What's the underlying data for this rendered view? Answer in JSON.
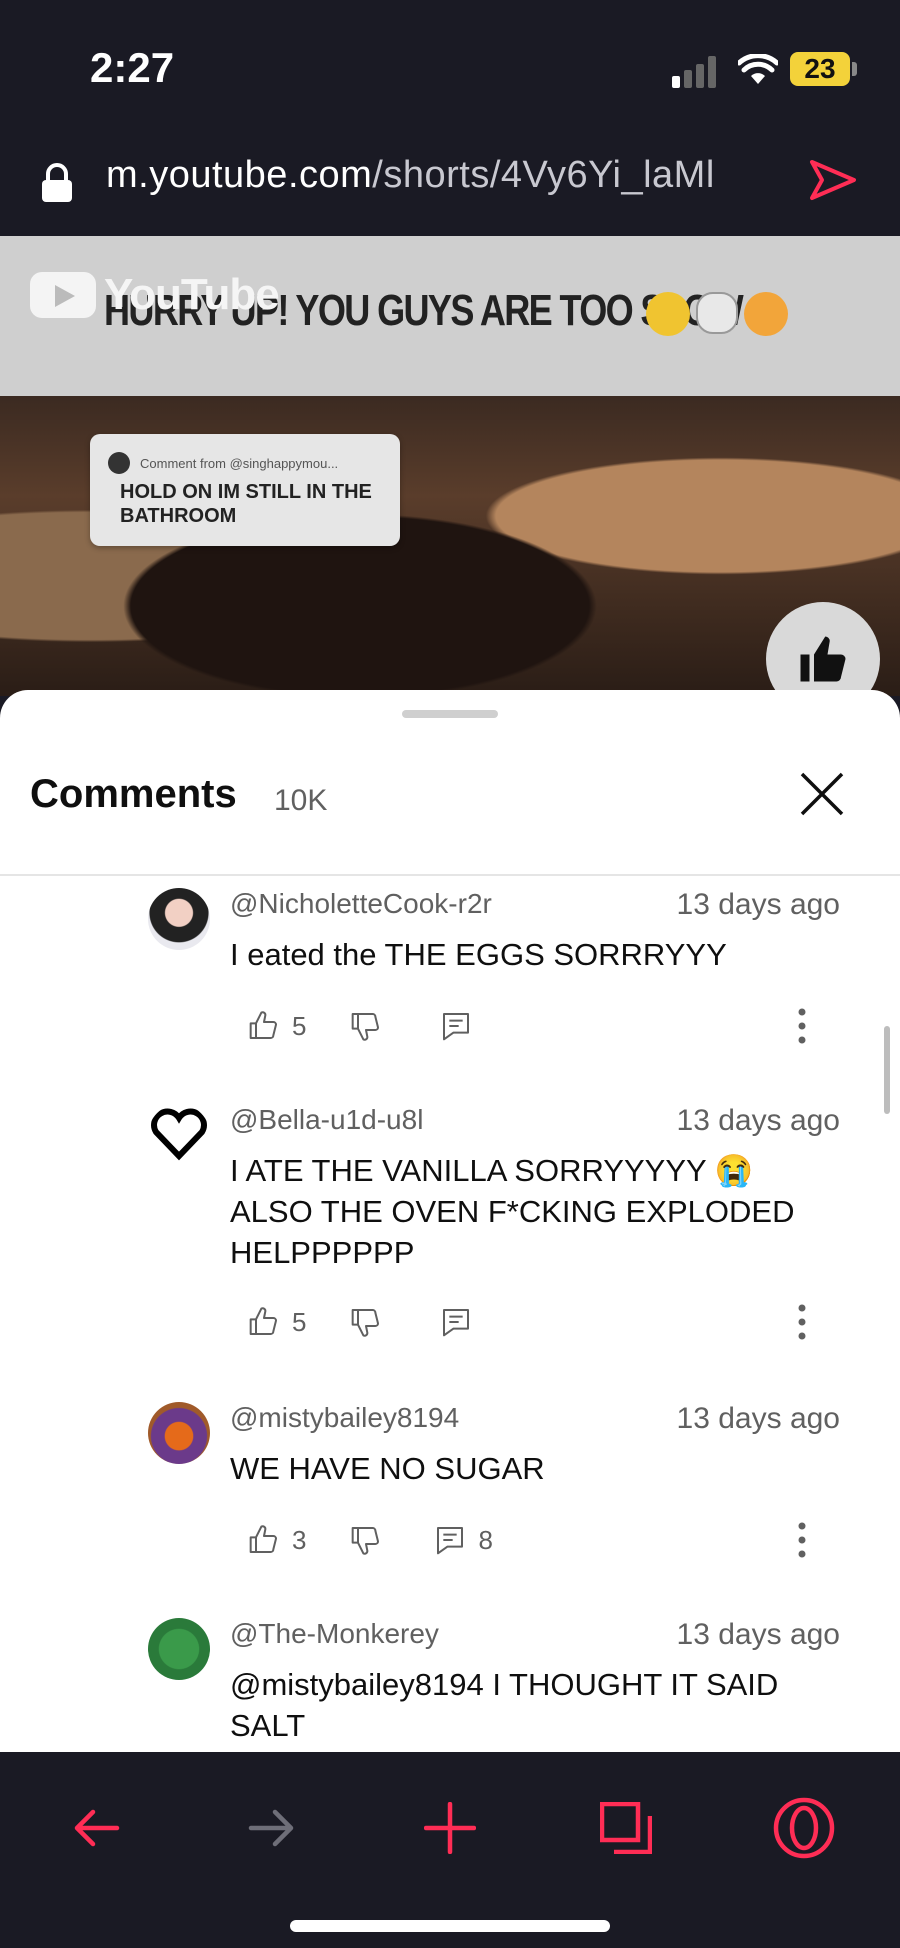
{
  "status_bar": {
    "time": "2:27",
    "battery": "23"
  },
  "browser": {
    "url_host": "m.youtube.com",
    "url_path": "/shorts/4Vy6Yi_laMl"
  },
  "video": {
    "logo_text": "YouTube",
    "banner_text": "HURRY UP! YOU GUYS ARE TOO SLOW",
    "reply_card": {
      "from": "Comment from @singhappymou...",
      "text": "HOLD ON IM STILL IN THE BATHROOM"
    }
  },
  "comments_panel": {
    "title": "Comments",
    "count": "10K",
    "items": [
      {
        "author": "@NicholetteCook-r2r",
        "age": "13 days ago",
        "text": "I eated the THE EGGS SORRRYYY",
        "likes": "5",
        "replies": ""
      },
      {
        "author": "@Bella-u1d-u8l",
        "age": "13 days ago",
        "text": "I ATE THE VANILLA SORRYYYYY 😭 ALSO THE OVEN F*CKING EXPLODED HELPPPPPP",
        "likes": "5",
        "replies": ""
      },
      {
        "author": "@mistybailey8194",
        "age": "13 days ago",
        "text": "WE HAVE NO SUGAR",
        "likes": "3",
        "replies": "8"
      },
      {
        "author": "@The-Monkerey",
        "age": "13 days ago",
        "text": "@mistybailey8194 I THOUGHT IT SAID SALT",
        "likes": "",
        "replies": ""
      }
    ]
  },
  "colors": {
    "accent": "#ff2d55",
    "chrome": "#1a1a24",
    "battery": "#f3d23a",
    "secondary_text": "#606060"
  },
  "icons": [
    "lock-icon",
    "send-icon",
    "thumbs-up-icon",
    "thumbs-down-icon",
    "reply-icon",
    "more-vert-icon",
    "close-icon",
    "back-arrow-icon",
    "forward-arrow-icon",
    "plus-icon",
    "tabs-icon",
    "opera-icon"
  ]
}
